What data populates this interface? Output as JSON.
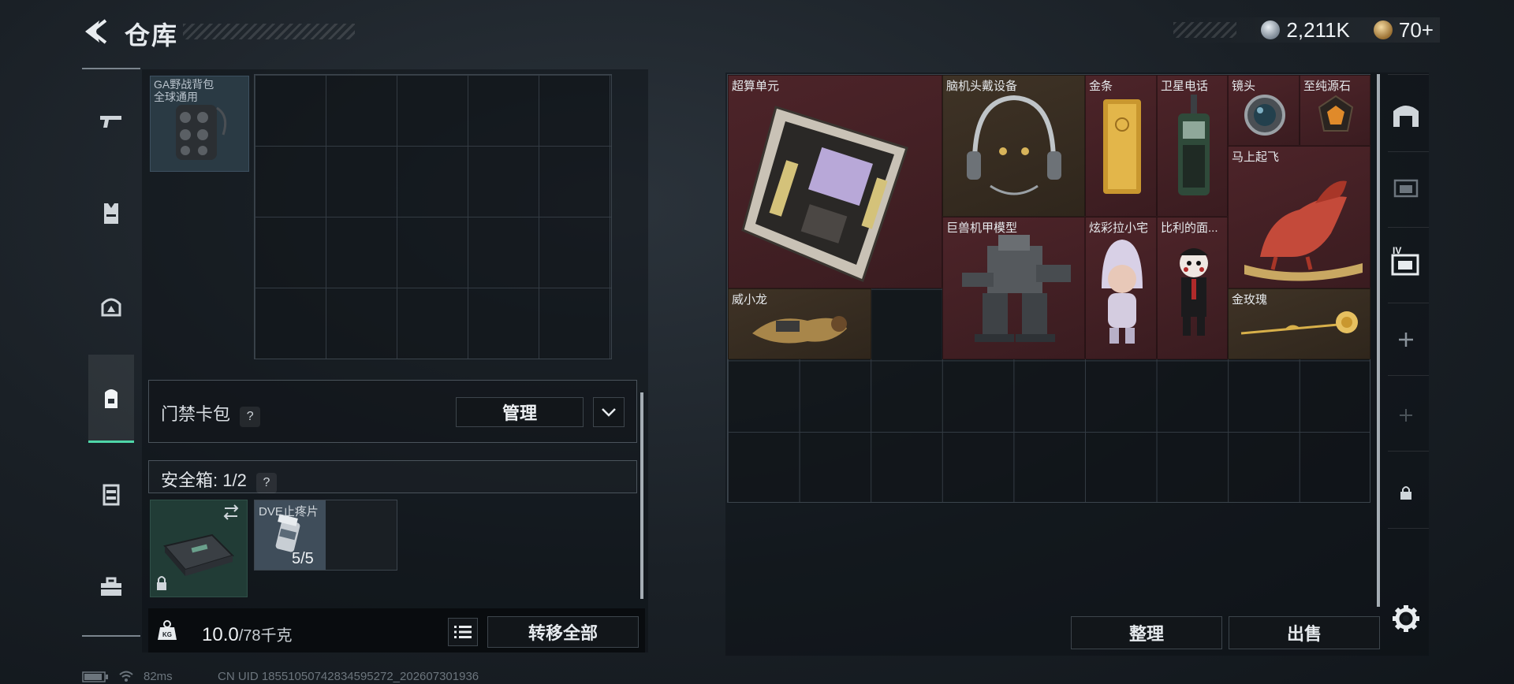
{
  "header": {
    "title": "仓库",
    "currencies": [
      {
        "icon": "silver-coin-icon",
        "value": "2,211K"
      },
      {
        "icon": "gold-coin-icon",
        "value": "70+"
      }
    ]
  },
  "left_rail": {
    "tabs": [
      {
        "icon": "gun-icon",
        "active": false
      },
      {
        "icon": "armor-vest-icon",
        "active": false
      },
      {
        "icon": "helmet-icon",
        "active": false
      },
      {
        "icon": "backpack-icon",
        "active": true
      },
      {
        "icon": "chest-rig-icon",
        "active": false
      },
      {
        "icon": "toolbox-icon",
        "active": false
      }
    ]
  },
  "loadout": {
    "backpack_label": "GA野战背包\n全球通用",
    "keycard_label": "门禁卡包",
    "help_glyph": "?",
    "manage_label": "管理",
    "safebox_label": "安全箱: 1/2",
    "safebox_item2_label": "DVE止疼片",
    "safebox_item2_count": "5/5",
    "weight_value": "10.0",
    "weight_max": "/78千克",
    "transfer_all_label": "转移全部"
  },
  "stash": {
    "items": [
      {
        "name": "超算单元",
        "color": "red"
      },
      {
        "name": "脑机头戴设备",
        "color": "brown"
      },
      {
        "name": "金条",
        "color": "red"
      },
      {
        "name": "卫星电话",
        "color": "red"
      },
      {
        "name": "镜头",
        "color": "red"
      },
      {
        "name": "至纯源石",
        "color": "red"
      },
      {
        "name": "马上起飞",
        "color": "red"
      },
      {
        "name": "巨兽机甲模型",
        "color": "red"
      },
      {
        "name": "炫彩拉小宅",
        "color": "red"
      },
      {
        "name": "比利的面...",
        "color": "red"
      },
      {
        "name": "威小龙",
        "color": "brown"
      },
      {
        "name": "金玫瑰",
        "color": "brown"
      }
    ],
    "sort_label": "整理",
    "sell_label": "出售"
  },
  "right_rail": {
    "tabs": [
      "stash-arch-icon",
      "warehouse-2-icon",
      "warehouse-4-icon",
      "add-icon",
      "add-disabled-icon",
      "lock-icon"
    ],
    "roman_label": "IV"
  },
  "status": {
    "ping": "82ms",
    "uid": "CN UID 185510507428345952​72_202607301936"
  },
  "colors": {
    "accent_green": "#4fd6a8",
    "rarity_red": "#4d2429",
    "rarity_brown": "#3f3326"
  }
}
